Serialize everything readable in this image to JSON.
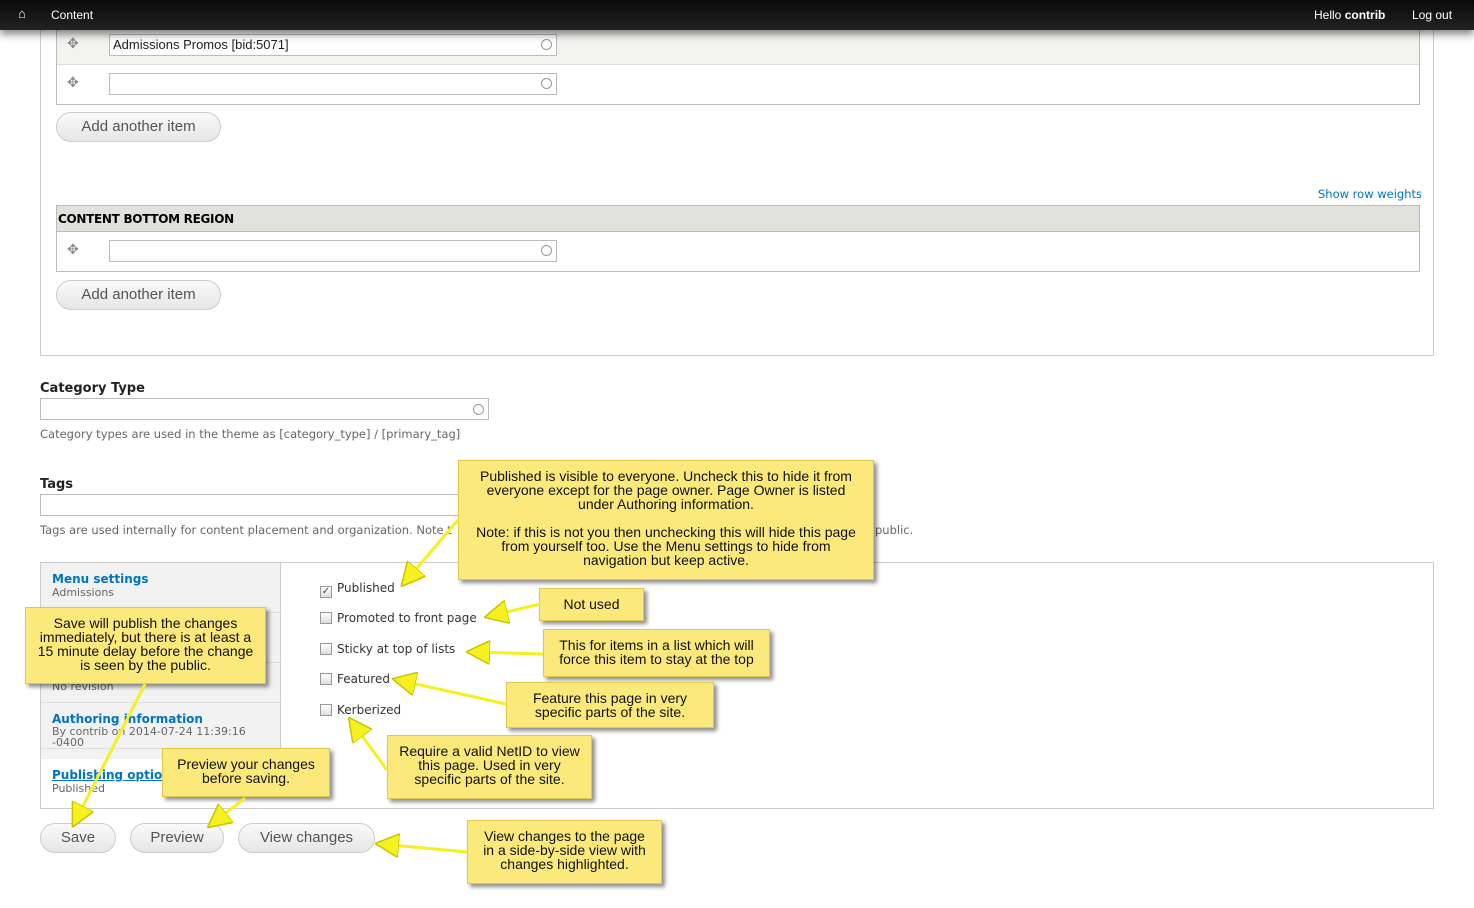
{
  "topbar": {
    "content": "Content",
    "hello": "Hello",
    "user": "contrib",
    "logout": "Log out"
  },
  "region_top": {
    "rows": [
      {
        "value": "Admissions Promos [bid:5071]"
      },
      {
        "value": ""
      }
    ],
    "add_label": "Add another item"
  },
  "show_row_weights": "Show row weights",
  "region_bottom": {
    "title": "CONTENT BOTTOM REGION",
    "rows": [
      {
        "value": ""
      }
    ],
    "add_label": "Add another item"
  },
  "category_type": {
    "label": "Category Type",
    "value": "",
    "description": "Category types are used in the theme as [category_type] / [primary_tag]"
  },
  "tags": {
    "label": "Tags",
    "value": "",
    "description_start": "Tags are used internally for content placement and organization. Note t",
    "description_end": "public."
  },
  "vertical_tabs": [
    {
      "title": "Menu settings",
      "summary": "Admissions"
    },
    {
      "title": "",
      "summary": "No revision"
    },
    {
      "title": "Authoring information",
      "summary": "By contrib on 2014-07-24 11:39:16 -0400"
    },
    {
      "title": "Publishing options",
      "summary": "Published"
    }
  ],
  "options": [
    {
      "label": "Published",
      "checked": true
    },
    {
      "label": "Promoted to front page",
      "checked": false
    },
    {
      "label": "Sticky at top of lists",
      "checked": false
    },
    {
      "label": "Featured",
      "checked": false
    },
    {
      "label": "Kerberized",
      "checked": false
    }
  ],
  "actions": {
    "save": "Save",
    "preview": "Preview",
    "view_changes": "View changes"
  },
  "callouts": {
    "published": "Published is visible to everyone. Uncheck this to hide it from everyone except for the page owner. Page Owner is listed under Authoring information.\n\nNote: if this is not you then unchecking this will hide this page from yourself too. Use the Menu settings to hide from navigation but keep active.",
    "not_used": "Not used",
    "sticky": "This for items in a list which will force this item to stay at the top",
    "featured": "Feature this page in very specific parts of the site.",
    "kerberized": "Require a valid NetID to view this page. Used in very specific parts of the site.",
    "save": "Save will publish the changes immediately, but there is at least a 15 minute delay before the change is seen by the public.",
    "preview": "Preview your changes before saving.",
    "view_changes": "View changes to the page in a side-by-side view with changes highlighted."
  },
  "colors": {
    "callout": "#fce97c",
    "arrow": "#f5f01e",
    "link": "#0074bd",
    "topbar": "#111111"
  }
}
